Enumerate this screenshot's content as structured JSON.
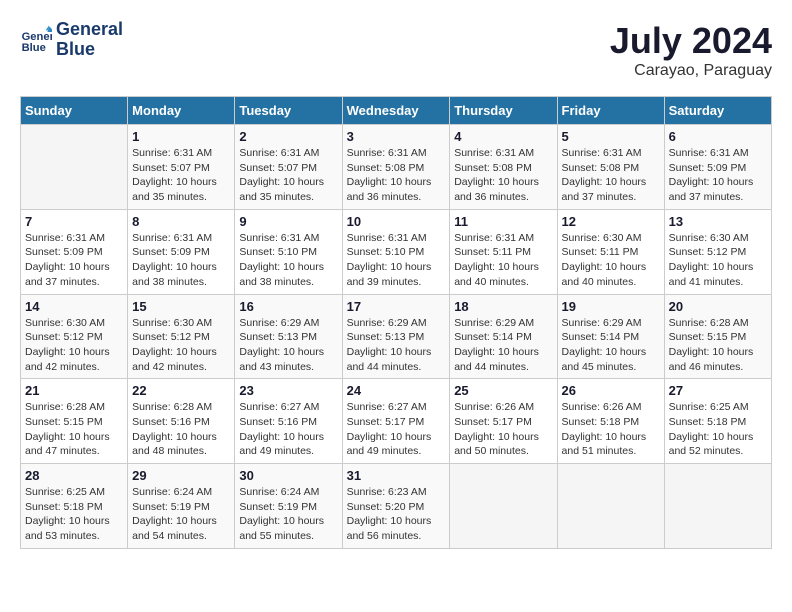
{
  "header": {
    "logo_line1": "General",
    "logo_line2": "Blue",
    "month_year": "July 2024",
    "location": "Carayao, Paraguay"
  },
  "calendar": {
    "days_of_week": [
      "Sunday",
      "Monday",
      "Tuesday",
      "Wednesday",
      "Thursday",
      "Friday",
      "Saturday"
    ],
    "weeks": [
      [
        {
          "day": "",
          "sunrise": "",
          "sunset": "",
          "daylight": ""
        },
        {
          "day": "1",
          "sunrise": "Sunrise: 6:31 AM",
          "sunset": "Sunset: 5:07 PM",
          "daylight": "Daylight: 10 hours and 35 minutes."
        },
        {
          "day": "2",
          "sunrise": "Sunrise: 6:31 AM",
          "sunset": "Sunset: 5:07 PM",
          "daylight": "Daylight: 10 hours and 35 minutes."
        },
        {
          "day": "3",
          "sunrise": "Sunrise: 6:31 AM",
          "sunset": "Sunset: 5:08 PM",
          "daylight": "Daylight: 10 hours and 36 minutes."
        },
        {
          "day": "4",
          "sunrise": "Sunrise: 6:31 AM",
          "sunset": "Sunset: 5:08 PM",
          "daylight": "Daylight: 10 hours and 36 minutes."
        },
        {
          "day": "5",
          "sunrise": "Sunrise: 6:31 AM",
          "sunset": "Sunset: 5:08 PM",
          "daylight": "Daylight: 10 hours and 37 minutes."
        },
        {
          "day": "6",
          "sunrise": "Sunrise: 6:31 AM",
          "sunset": "Sunset: 5:09 PM",
          "daylight": "Daylight: 10 hours and 37 minutes."
        }
      ],
      [
        {
          "day": "7",
          "sunrise": "Sunrise: 6:31 AM",
          "sunset": "Sunset: 5:09 PM",
          "daylight": "Daylight: 10 hours and 37 minutes."
        },
        {
          "day": "8",
          "sunrise": "Sunrise: 6:31 AM",
          "sunset": "Sunset: 5:09 PM",
          "daylight": "Daylight: 10 hours and 38 minutes."
        },
        {
          "day": "9",
          "sunrise": "Sunrise: 6:31 AM",
          "sunset": "Sunset: 5:10 PM",
          "daylight": "Daylight: 10 hours and 38 minutes."
        },
        {
          "day": "10",
          "sunrise": "Sunrise: 6:31 AM",
          "sunset": "Sunset: 5:10 PM",
          "daylight": "Daylight: 10 hours and 39 minutes."
        },
        {
          "day": "11",
          "sunrise": "Sunrise: 6:31 AM",
          "sunset": "Sunset: 5:11 PM",
          "daylight": "Daylight: 10 hours and 40 minutes."
        },
        {
          "day": "12",
          "sunrise": "Sunrise: 6:30 AM",
          "sunset": "Sunset: 5:11 PM",
          "daylight": "Daylight: 10 hours and 40 minutes."
        },
        {
          "day": "13",
          "sunrise": "Sunrise: 6:30 AM",
          "sunset": "Sunset: 5:12 PM",
          "daylight": "Daylight: 10 hours and 41 minutes."
        }
      ],
      [
        {
          "day": "14",
          "sunrise": "Sunrise: 6:30 AM",
          "sunset": "Sunset: 5:12 PM",
          "daylight": "Daylight: 10 hours and 42 minutes."
        },
        {
          "day": "15",
          "sunrise": "Sunrise: 6:30 AM",
          "sunset": "Sunset: 5:12 PM",
          "daylight": "Daylight: 10 hours and 42 minutes."
        },
        {
          "day": "16",
          "sunrise": "Sunrise: 6:29 AM",
          "sunset": "Sunset: 5:13 PM",
          "daylight": "Daylight: 10 hours and 43 minutes."
        },
        {
          "day": "17",
          "sunrise": "Sunrise: 6:29 AM",
          "sunset": "Sunset: 5:13 PM",
          "daylight": "Daylight: 10 hours and 44 minutes."
        },
        {
          "day": "18",
          "sunrise": "Sunrise: 6:29 AM",
          "sunset": "Sunset: 5:14 PM",
          "daylight": "Daylight: 10 hours and 44 minutes."
        },
        {
          "day": "19",
          "sunrise": "Sunrise: 6:29 AM",
          "sunset": "Sunset: 5:14 PM",
          "daylight": "Daylight: 10 hours and 45 minutes."
        },
        {
          "day": "20",
          "sunrise": "Sunrise: 6:28 AM",
          "sunset": "Sunset: 5:15 PM",
          "daylight": "Daylight: 10 hours and 46 minutes."
        }
      ],
      [
        {
          "day": "21",
          "sunrise": "Sunrise: 6:28 AM",
          "sunset": "Sunset: 5:15 PM",
          "daylight": "Daylight: 10 hours and 47 minutes."
        },
        {
          "day": "22",
          "sunrise": "Sunrise: 6:28 AM",
          "sunset": "Sunset: 5:16 PM",
          "daylight": "Daylight: 10 hours and 48 minutes."
        },
        {
          "day": "23",
          "sunrise": "Sunrise: 6:27 AM",
          "sunset": "Sunset: 5:16 PM",
          "daylight": "Daylight: 10 hours and 49 minutes."
        },
        {
          "day": "24",
          "sunrise": "Sunrise: 6:27 AM",
          "sunset": "Sunset: 5:17 PM",
          "daylight": "Daylight: 10 hours and 49 minutes."
        },
        {
          "day": "25",
          "sunrise": "Sunrise: 6:26 AM",
          "sunset": "Sunset: 5:17 PM",
          "daylight": "Daylight: 10 hours and 50 minutes."
        },
        {
          "day": "26",
          "sunrise": "Sunrise: 6:26 AM",
          "sunset": "Sunset: 5:18 PM",
          "daylight": "Daylight: 10 hours and 51 minutes."
        },
        {
          "day": "27",
          "sunrise": "Sunrise: 6:25 AM",
          "sunset": "Sunset: 5:18 PM",
          "daylight": "Daylight: 10 hours and 52 minutes."
        }
      ],
      [
        {
          "day": "28",
          "sunrise": "Sunrise: 6:25 AM",
          "sunset": "Sunset: 5:18 PM",
          "daylight": "Daylight: 10 hours and 53 minutes."
        },
        {
          "day": "29",
          "sunrise": "Sunrise: 6:24 AM",
          "sunset": "Sunset: 5:19 PM",
          "daylight": "Daylight: 10 hours and 54 minutes."
        },
        {
          "day": "30",
          "sunrise": "Sunrise: 6:24 AM",
          "sunset": "Sunset: 5:19 PM",
          "daylight": "Daylight: 10 hours and 55 minutes."
        },
        {
          "day": "31",
          "sunrise": "Sunrise: 6:23 AM",
          "sunset": "Sunset: 5:20 PM",
          "daylight": "Daylight: 10 hours and 56 minutes."
        },
        {
          "day": "",
          "sunrise": "",
          "sunset": "",
          "daylight": ""
        },
        {
          "day": "",
          "sunrise": "",
          "sunset": "",
          "daylight": ""
        },
        {
          "day": "",
          "sunrise": "",
          "sunset": "",
          "daylight": ""
        }
      ]
    ]
  }
}
